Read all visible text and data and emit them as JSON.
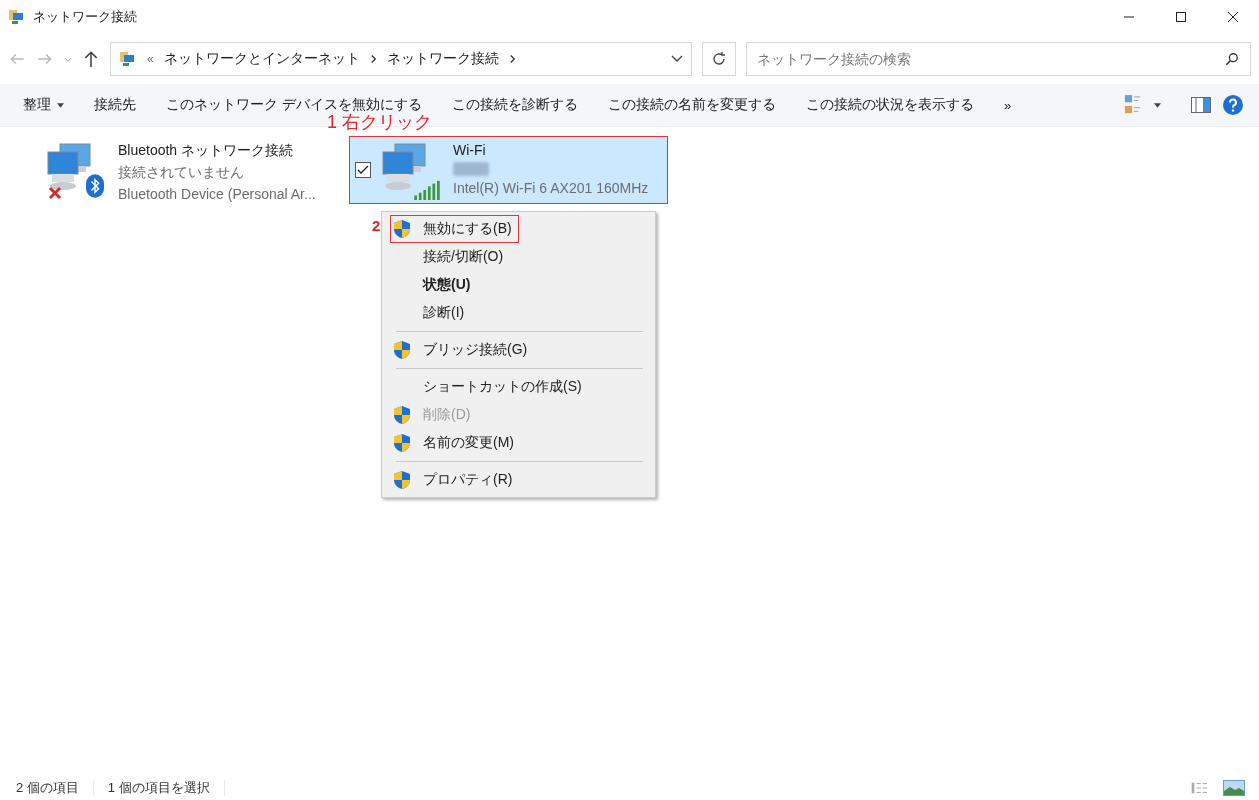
{
  "window": {
    "title": "ネットワーク接続"
  },
  "address_bar": {
    "overflow": "«",
    "path": [
      "ネットワークとインターネット",
      "ネットワーク接続"
    ]
  },
  "search": {
    "placeholder": "ネットワーク接続の検索"
  },
  "toolbar": {
    "buttons": [
      {
        "label": "整理",
        "dropdown": true
      },
      {
        "label": "接続先",
        "dropdown": false
      },
      {
        "label": "このネットワーク デバイスを無効にする",
        "dropdown": false
      },
      {
        "label": "この接続を診断する",
        "dropdown": false
      },
      {
        "label": "この接続の名前を変更する",
        "dropdown": false
      },
      {
        "label": "この接続の状況を表示する",
        "dropdown": false
      }
    ],
    "more": "»"
  },
  "connections": [
    {
      "kind": "bluetooth",
      "name": "Bluetooth ネットワーク接続",
      "status": "接続されていません",
      "device": "Bluetooth Device (Personal Ar...",
      "selected": false,
      "disconnected": true,
      "status_hidden": false
    },
    {
      "kind": "wifi",
      "name": "Wi-Fi",
      "device": "Intel(R) Wi-Fi 6 AX201 160MHz",
      "selected": true,
      "disconnected": false,
      "status_hidden": true
    }
  ],
  "context_menu": [
    {
      "kind": "item",
      "label": "無効にする(B)",
      "shield": true,
      "bold": false,
      "disabled": false,
      "highlighted": true
    },
    {
      "kind": "item",
      "label": "接続/切断(O)",
      "shield": false,
      "bold": false,
      "disabled": false,
      "highlighted": false
    },
    {
      "kind": "item",
      "label": "状態(U)",
      "shield": false,
      "bold": true,
      "disabled": false,
      "highlighted": false
    },
    {
      "kind": "item",
      "label": "診断(I)",
      "shield": false,
      "bold": false,
      "disabled": false,
      "highlighted": false
    },
    {
      "kind": "separator"
    },
    {
      "kind": "item",
      "label": "ブリッジ接続(G)",
      "shield": true,
      "bold": false,
      "disabled": false,
      "highlighted": false
    },
    {
      "kind": "separator"
    },
    {
      "kind": "item",
      "label": "ショートカットの作成(S)",
      "shield": false,
      "bold": false,
      "disabled": false,
      "highlighted": false
    },
    {
      "kind": "item",
      "label": "削除(D)",
      "shield": true,
      "bold": false,
      "disabled": true,
      "highlighted": false
    },
    {
      "kind": "item",
      "label": "名前の変更(M)",
      "shield": true,
      "bold": false,
      "disabled": false,
      "highlighted": false
    },
    {
      "kind": "separator"
    },
    {
      "kind": "item",
      "label": "プロパティ(R)",
      "shield": true,
      "bold": false,
      "disabled": false,
      "highlighted": false
    }
  ],
  "annotations": [
    {
      "number": "1",
      "text": "右クリック"
    },
    {
      "number": "2"
    }
  ],
  "status_bar": {
    "count": "2 個の項目",
    "selection": "1 個の項目を選択"
  }
}
